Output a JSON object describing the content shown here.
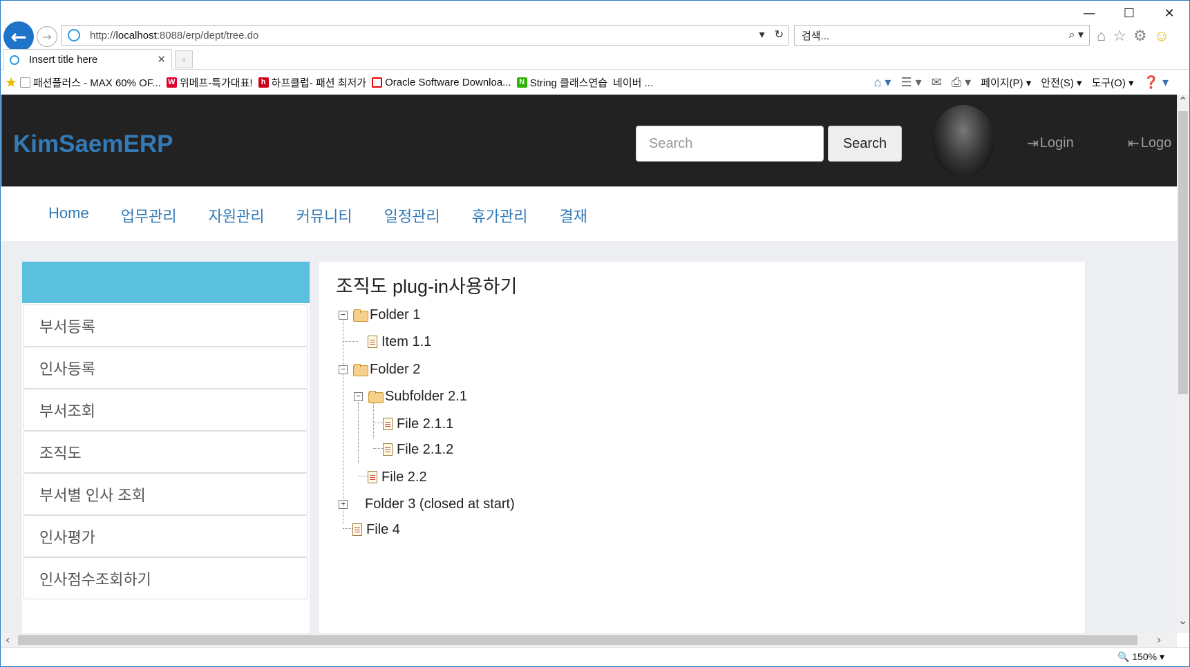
{
  "browser": {
    "url_prefix": "http://",
    "url_host": "localhost",
    "url_rest": ":8088/erp/dept/tree.do",
    "search_placeholder": "검색...",
    "tab_title": "Insert title here",
    "favorites": [
      {
        "icon": "page-icon",
        "label": "패션플러스 - MAX 60% OF..."
      },
      {
        "icon": "w-icon",
        "label": "위메프-특가대표!"
      },
      {
        "icon": "h-icon",
        "label": "하프클럽- 패션 최저가"
      },
      {
        "icon": "oracle-icon",
        "label": "Oracle Software Downloa..."
      },
      {
        "icon": "naver-icon",
        "label": "String 클래스연습"
      },
      {
        "icon": "",
        "label": "네이버 ..."
      }
    ],
    "commands": {
      "page": "페이지(P)",
      "safety": "안전(S)",
      "tools": "도구(O)"
    },
    "zoom": "150%"
  },
  "site": {
    "brand": "KimSaemERP",
    "search_placeholder": "Search",
    "search_button": "Search",
    "login": "Login",
    "logout": "Logo",
    "nav": [
      "Home",
      "업무관리",
      "자원관리",
      "커뮤니티",
      "일정관리",
      "휴가관리",
      "결재"
    ]
  },
  "sidebar": {
    "items": [
      "부서등록",
      "인사등록",
      "부서조회",
      "조직도",
      "부서별 인사 조회",
      "인사평가",
      "인사점수조회하기"
    ]
  },
  "main": {
    "title": "조직도 plug-in사용하기",
    "tree": [
      {
        "label": "Folder 1",
        "kind": "folder",
        "expander": "minus"
      },
      {
        "label": "Item 1.1",
        "kind": "file"
      },
      {
        "label": "Folder 2",
        "kind": "folder",
        "expander": "minus"
      },
      {
        "label": "Subfolder 2.1",
        "kind": "folder",
        "expander": "minus"
      },
      {
        "label": "File 2.1.1",
        "kind": "file"
      },
      {
        "label": "File 2.1.2",
        "kind": "file"
      },
      {
        "label": "File 2.2",
        "kind": "file"
      },
      {
        "label": "Folder 3 (closed at start)",
        "kind": "folder-closed",
        "expander": "plus"
      },
      {
        "label": "File 4",
        "kind": "file"
      }
    ]
  },
  "colors": {
    "brand": "#337ab7",
    "header_bg": "#222222",
    "sidebar_head": "#5bc0de",
    "content_bg": "#eceef1"
  }
}
